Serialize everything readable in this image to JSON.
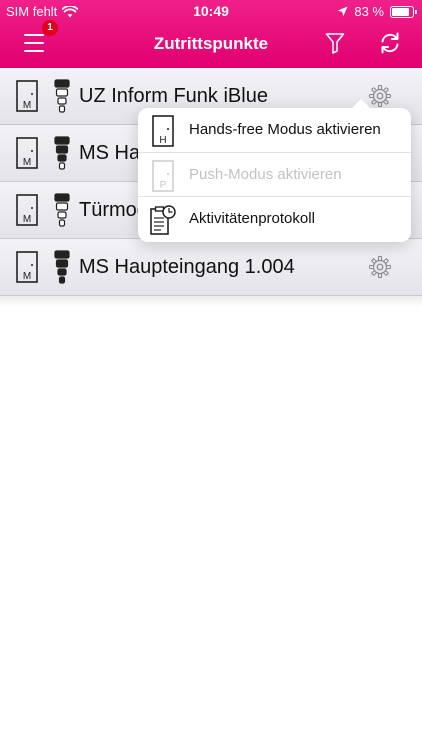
{
  "status_bar": {
    "carrier": "SIM fehlt",
    "time": "10:49",
    "battery_text": "83 %",
    "battery_level": 0.83
  },
  "navbar": {
    "title": "Zutrittspunkte",
    "menu_badge": "1"
  },
  "access_points": [
    {
      "name": "UZ Inform Funk iBlue",
      "door_letter": "M",
      "level_pattern": [
        1,
        0,
        0,
        0
      ]
    },
    {
      "name": "MS Hau",
      "door_letter": "M",
      "level_pattern": [
        1,
        1,
        1,
        0
      ]
    },
    {
      "name": "Türmod",
      "door_letter": "M",
      "level_pattern": [
        1,
        0,
        0,
        0
      ]
    },
    {
      "name": "MS Haupteingang 1.004",
      "door_letter": "M",
      "level_pattern": [
        1,
        1,
        1,
        1
      ]
    }
  ],
  "popover_menu": {
    "items": [
      {
        "label": "Hands-free Modus aktivieren",
        "icon_letter": "H",
        "enabled": true
      },
      {
        "label": "Push-Modus aktivieren",
        "icon_letter": "P",
        "enabled": false
      },
      {
        "label": "Aktivitätenprotokoll",
        "icon_letter": "",
        "enabled": true
      }
    ]
  },
  "colors": {
    "brand": "#e20074",
    "badge": "#e3001b",
    "row_bg": "#eceaf0",
    "disabled_text": "#c2c2c6"
  },
  "icons": {
    "menu": "hamburger-icon",
    "filter": "filter-icon",
    "sync": "sync-icon",
    "gear": "gear-icon",
    "door": "door-icon",
    "level": "signal-level-icon",
    "log": "activity-log-icon"
  }
}
